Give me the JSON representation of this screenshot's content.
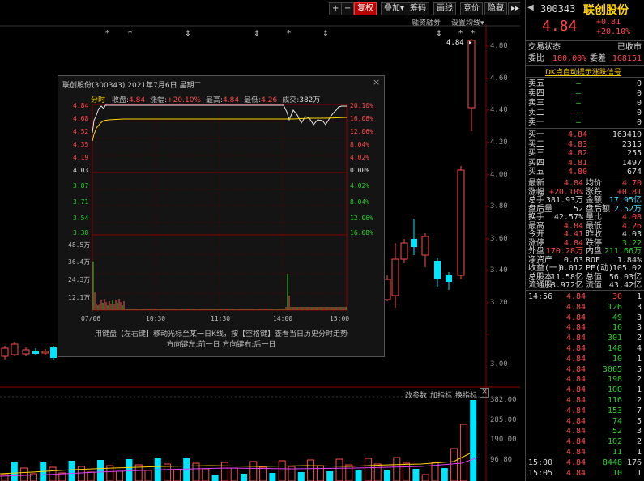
{
  "toolbar": {
    "plus": "+",
    "minus": "−",
    "prev": "←",
    "adjust": "复权",
    "overlay": "叠加",
    "chips": "筹码",
    "draw": "画线",
    "rights": "竞价",
    "hide": "隐藏",
    "next": "▸▸",
    "margin": "融资融券",
    "settings": "设置均线"
  },
  "main_axis": [
    "4.80",
    "4.60",
    "4.40",
    "4.20",
    "4.00",
    "3.80",
    "3.60",
    "3.40",
    "3.20",
    "3.00"
  ],
  "main_last_price": "4.84",
  "volume_axis": [
    "382.00",
    "285.00",
    "190.00",
    "96.80"
  ],
  "volume_menu": {
    "params": "改参数",
    "add": "加指标",
    "switch": "换指标",
    "close": "×"
  },
  "popup": {
    "title": "联创股份(300343) 2021年7月6日 星期二",
    "close": "×",
    "tab": "分时",
    "info": [
      {
        "label": "收盘:",
        "value": "4.84",
        "color": "#ff4b4b"
      },
      {
        "label": "涨幅:",
        "value": "+20.10%",
        "color": "#ff4b4b"
      },
      {
        "label": "最高:",
        "value": "4.84",
        "color": "#ff4b4b"
      },
      {
        "label": "最低:",
        "value": "4.26",
        "color": "#ff4b4b"
      },
      {
        "label": "成交:",
        "value": "382万",
        "color": "#dcdcdc"
      }
    ],
    "left_prices": [
      {
        "v": "4.84",
        "c": "#ff4b4b"
      },
      {
        "v": "4.68",
        "c": "#ff4b4b"
      },
      {
        "v": "4.52",
        "c": "#ff4b4b"
      },
      {
        "v": "4.35",
        "c": "#ff4b4b"
      },
      {
        "v": "4.19",
        "c": "#ff4b4b"
      },
      {
        "v": "4.03",
        "c": "#dcdcdc"
      },
      {
        "v": "3.87",
        "c": "#2fd12f"
      },
      {
        "v": "3.71",
        "c": "#2fd12f"
      },
      {
        "v": "3.54",
        "c": "#2fd12f"
      },
      {
        "v": "3.38",
        "c": "#2fd12f"
      }
    ],
    "right_pcts": [
      {
        "v": "20.10%",
        "c": "#ff4b4b"
      },
      {
        "v": "16.08%",
        "c": "#ff4b4b"
      },
      {
        "v": "12.06%",
        "c": "#ff4b4b"
      },
      {
        "v": "8.04%",
        "c": "#ff4b4b"
      },
      {
        "v": "4.02%",
        "c": "#ff4b4b"
      },
      {
        "v": "0.00%",
        "c": "#dcdcdc"
      },
      {
        "v": "4.02%",
        "c": "#2fd12f"
      },
      {
        "v": "8.04%",
        "c": "#2fd12f"
      },
      {
        "v": "12.06%",
        "c": "#2fd12f"
      },
      {
        "v": "16.08%",
        "c": "#2fd12f"
      }
    ],
    "vol_axis": [
      "48.5万",
      "36.4万",
      "24.3万",
      "12.1万"
    ],
    "time_axis": [
      "07/06",
      "10:30",
      "11:30",
      "14:00",
      "15:00"
    ],
    "hint1": "用键盘【左右键】移动光标至某一日K线，按【空格键】查看当日历史分时走势",
    "hint2": "方向键左:前一日    方向键右:后一日"
  },
  "quote": {
    "code": "300343",
    "name": "联创股份",
    "price": "4.84",
    "change": "+0.81",
    "change_pct": "+20.10%",
    "status_label": "交易状态",
    "status_value": "已收市",
    "ratio_label": "委比",
    "ratio_value": "100.00%",
    "diff_label": "委差",
    "diff_value": "168151",
    "signal": "DK点自动提示涨跌信号",
    "asks": [
      {
        "label": "卖五",
        "price": "—",
        "vol": "0"
      },
      {
        "label": "卖四",
        "price": "—",
        "vol": "0"
      },
      {
        "label": "卖三",
        "price": "—",
        "vol": "0"
      },
      {
        "label": "卖二",
        "price": "—",
        "vol": "0"
      },
      {
        "label": "卖一",
        "price": "—",
        "vol": "0"
      }
    ],
    "bids": [
      {
        "label": "买一",
        "price": "4.84",
        "vol": "163410"
      },
      {
        "label": "买二",
        "price": "4.83",
        "vol": "2315"
      },
      {
        "label": "买三",
        "price": "4.82",
        "vol": "255"
      },
      {
        "label": "买四",
        "price": "4.81",
        "vol": "1497"
      },
      {
        "label": "买五",
        "price": "4.80",
        "vol": "674"
      }
    ],
    "stats": [
      {
        "l1": "最新",
        "v1": "4.84",
        "c1": "r",
        "l2": "均价",
        "v2": "4.70",
        "c2": "r"
      },
      {
        "l1": "涨幅",
        "v1": "+20.10%",
        "c1": "r",
        "l2": "涨跌",
        "v2": "+0.81",
        "c2": "r"
      },
      {
        "l1": "总手",
        "v1": "381.93万",
        "c1": "w",
        "l2": "金额",
        "v2": "17.95亿",
        "c2": "c"
      },
      {
        "l1": "盘后量",
        "v1": "52",
        "c1": "w",
        "l2": "盘后额",
        "v2": "2.52万",
        "c2": "c"
      },
      {
        "l1": "换手",
        "v1": "42.57%",
        "c1": "w",
        "l2": "量比",
        "v2": "4.08",
        "c2": "r"
      },
      {
        "l1": "最高",
        "v1": "4.84",
        "c1": "r",
        "l2": "最低",
        "v2": "4.26",
        "c2": "r"
      },
      {
        "l1": "今开",
        "v1": "4.41",
        "c1": "r",
        "l2": "昨收",
        "v2": "4.03",
        "c2": "w"
      },
      {
        "l1": "涨停",
        "v1": "4.84",
        "c1": "r",
        "l2": "跌停",
        "v2": "3.22",
        "c2": "g"
      },
      {
        "l1": "外盘",
        "v1": "170.28万",
        "c1": "r",
        "l2": "内盘",
        "v2": "211.66万",
        "c2": "g"
      },
      {
        "l1": "净资产",
        "v1": "0.63",
        "c1": "w",
        "l2": "ROE",
        "v2": "1.84%",
        "c2": "w"
      },
      {
        "l1": "收益(一)",
        "v1": "0.012",
        "c1": "w",
        "l2": "PE(动)",
        "v2": "105.02",
        "c2": "w"
      },
      {
        "l1": "总股本",
        "v1": "11.58亿",
        "c1": "w",
        "l2": "总值",
        "v2": "56.03亿",
        "c2": "w"
      },
      {
        "l1": "流通股",
        "v1": "8.972亿",
        "c1": "w",
        "l2": "流值",
        "v2": "43.42亿",
        "c2": "w"
      }
    ],
    "ticks": [
      {
        "t": "14:56",
        "p": "4.84",
        "v": "30",
        "n": "1",
        "vc": "r"
      },
      {
        "t": "",
        "p": "4.84",
        "v": "126",
        "n": "3",
        "vc": "g"
      },
      {
        "t": "",
        "p": "4.84",
        "v": "49",
        "n": "3",
        "vc": "g"
      },
      {
        "t": "",
        "p": "4.84",
        "v": "16",
        "n": "3",
        "vc": "g"
      },
      {
        "t": "",
        "p": "4.84",
        "v": "301",
        "n": "2",
        "vc": "g"
      },
      {
        "t": "",
        "p": "4.84",
        "v": "148",
        "n": "4",
        "vc": "g"
      },
      {
        "t": "",
        "p": "4.84",
        "v": "10",
        "n": "1",
        "vc": "g"
      },
      {
        "t": "",
        "p": "4.84",
        "v": "3065",
        "n": "5",
        "vc": "g"
      },
      {
        "t": "",
        "p": "4.84",
        "v": "198",
        "n": "2",
        "vc": "g"
      },
      {
        "t": "",
        "p": "4.84",
        "v": "100",
        "n": "1",
        "vc": "g"
      },
      {
        "t": "",
        "p": "4.84",
        "v": "116",
        "n": "2",
        "vc": "g"
      },
      {
        "t": "",
        "p": "4.84",
        "v": "153",
        "n": "7",
        "vc": "g"
      },
      {
        "t": "",
        "p": "4.84",
        "v": "74",
        "n": "5",
        "vc": "g"
      },
      {
        "t": "",
        "p": "4.84",
        "v": "52",
        "n": "3",
        "vc": "g"
      },
      {
        "t": "",
        "p": "4.84",
        "v": "102",
        "n": "2",
        "vc": "g"
      },
      {
        "t": "",
        "p": "4.84",
        "v": "11",
        "n": "1",
        "vc": "g"
      },
      {
        "t": "15:00",
        "p": "4.84",
        "v": "8448",
        "n": "176",
        "vc": "g"
      },
      {
        "t": "15:05",
        "p": "4.84",
        "v": "10",
        "n": "1",
        "vc": "g"
      }
    ]
  },
  "colors": {
    "up": "#ff4b4b",
    "down": "#2fd12f",
    "neutral": "#dcdcdc",
    "volume_down": "#00e5ff",
    "accent": "#ffd200"
  }
}
